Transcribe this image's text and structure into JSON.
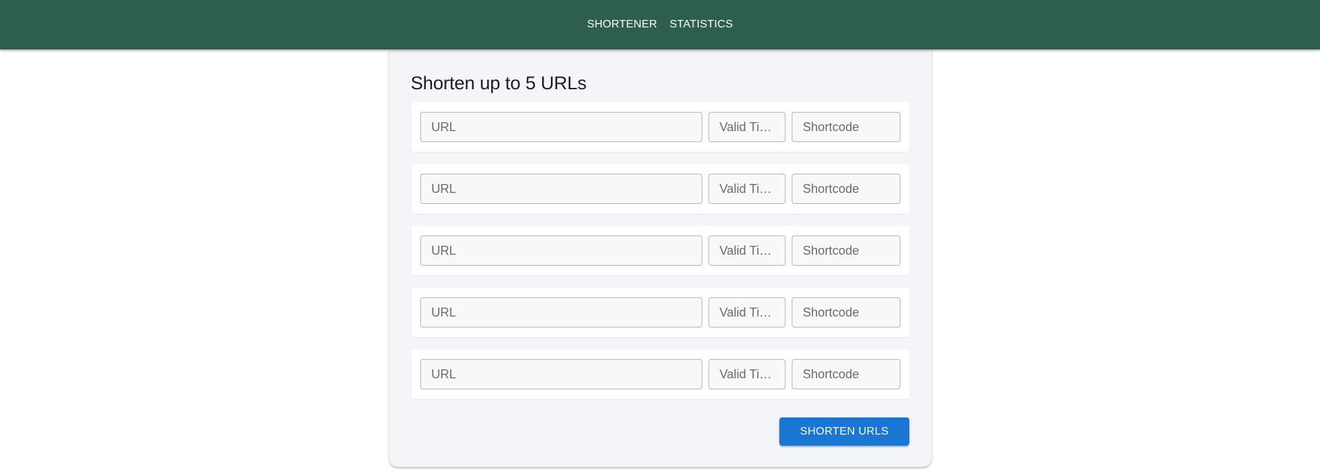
{
  "nav": {
    "items": [
      {
        "label": "SHORTENER"
      },
      {
        "label": "STATISTICS"
      }
    ]
  },
  "form": {
    "title": "Shorten up to 5 URLs",
    "rows": [
      {
        "url_placeholder": "URL",
        "validity_placeholder": "Valid Time (minutes)",
        "shortcode_placeholder": "Shortcode"
      },
      {
        "url_placeholder": "URL",
        "validity_placeholder": "Valid Time (minutes)",
        "shortcode_placeholder": "Shortcode"
      },
      {
        "url_placeholder": "URL",
        "validity_placeholder": "Valid Time (minutes)",
        "shortcode_placeholder": "Shortcode"
      },
      {
        "url_placeholder": "URL",
        "validity_placeholder": "Valid Time (minutes)",
        "shortcode_placeholder": "Shortcode"
      },
      {
        "url_placeholder": "URL",
        "validity_placeholder": "Valid Time (minutes)",
        "shortcode_placeholder": "Shortcode"
      }
    ],
    "submit_label": "SHORTEN URLS"
  },
  "colors": {
    "appbar": "#2e5e4e",
    "primary_button": "#1976d2",
    "card_background": "#f4f5f8"
  }
}
